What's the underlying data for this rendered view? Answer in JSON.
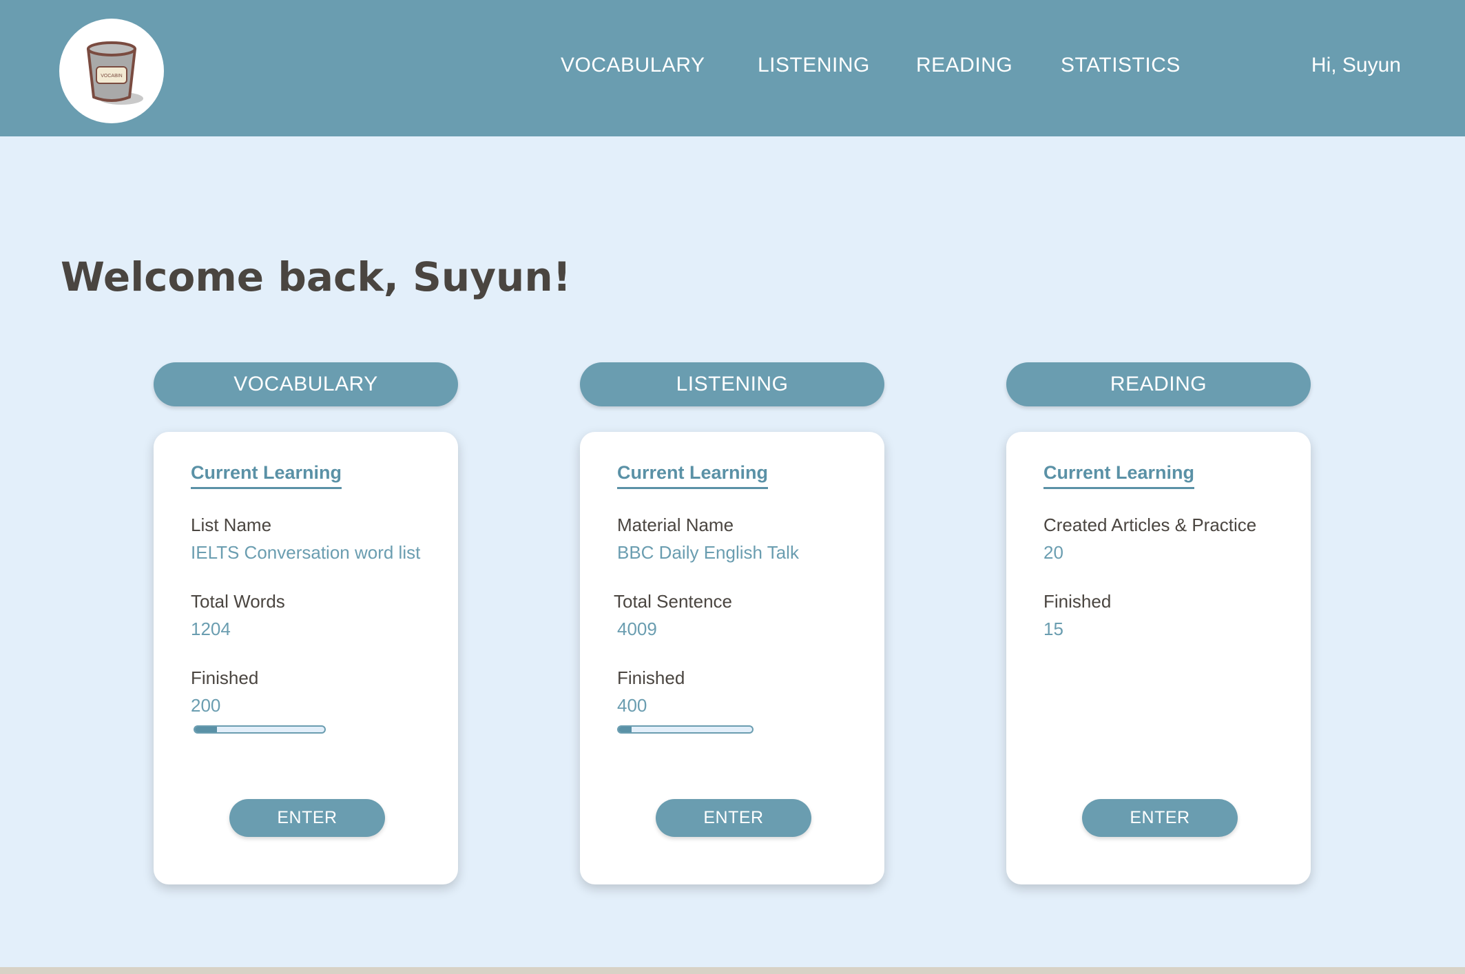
{
  "header": {
    "logo_text": "VOCABIN",
    "nav": [
      "VOCABULARY",
      "LISTENING",
      "READING",
      "STATISTICS"
    ],
    "greeting": "Hi, Suyun"
  },
  "welcome": "Welcome back, Suyun!",
  "colors": {
    "header": "#6a9db0",
    "background": "#e3effa",
    "accent": "#5a91a6",
    "text": "#4a4540"
  },
  "cards": [
    {
      "section": "VOCABULARY",
      "title": "Current Learning",
      "fields": [
        {
          "label": "List Name",
          "value": "IELTS Conversation word list"
        },
        {
          "label": "Total Words",
          "value": "1204"
        },
        {
          "label": "Finished",
          "value": "200"
        }
      ],
      "progress_fraction": 0.17,
      "button": "ENTER"
    },
    {
      "section": "LISTENING",
      "title": "Current Learning",
      "fields": [
        {
          "label": "Material Name",
          "value": "BBC Daily English Talk"
        },
        {
          "label": "Total Sentence",
          "value": "4009"
        },
        {
          "label": "Finished",
          "value": "400"
        }
      ],
      "progress_fraction": 0.1,
      "button": "ENTER"
    },
    {
      "section": "READING",
      "title": "Current Learning",
      "fields": [
        {
          "label": "Created Articles & Practice",
          "value": "20"
        },
        {
          "label": "Finished",
          "value": "15"
        }
      ],
      "button": "ENTER"
    }
  ]
}
